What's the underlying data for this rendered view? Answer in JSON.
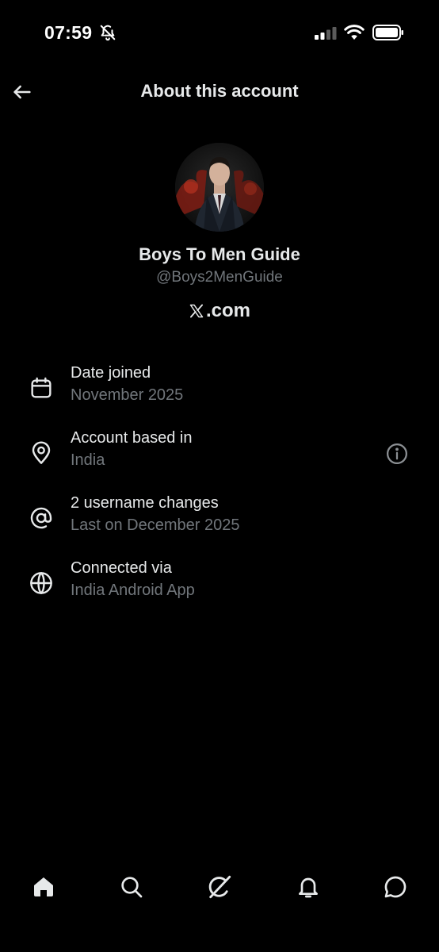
{
  "status_bar": {
    "time": "07:59",
    "icons": [
      "bell-slash-icon",
      "signal-icon",
      "wifi-icon",
      "battery-icon"
    ]
  },
  "header": {
    "title": "About this account",
    "back_icon": "arrow-left-icon"
  },
  "profile": {
    "name": "Boys To Men Guide",
    "handle": "@Boys2MenGuide",
    "platform_text": ".com",
    "platform_logo": "x-logo-icon"
  },
  "info_rows": [
    {
      "icon": "calendar-icon",
      "title": "Date joined",
      "subtitle": "November 2025"
    },
    {
      "icon": "location-pin-icon",
      "title": "Account based in",
      "subtitle": "India",
      "action_icon": "info-circle-icon"
    },
    {
      "icon": "at-sign-icon",
      "title": "2 username changes",
      "subtitle": "Last on December 2025"
    },
    {
      "icon": "globe-icon",
      "title": "Connected via",
      "subtitle": "India Android App"
    }
  ],
  "bottom_nav": {
    "items": [
      "home-icon",
      "search-icon",
      "grok-icon",
      "notifications-icon",
      "messages-icon"
    ]
  },
  "colors": {
    "background": "#000000",
    "primary_text": "#e7e9ea",
    "secondary_text": "#71767b"
  }
}
